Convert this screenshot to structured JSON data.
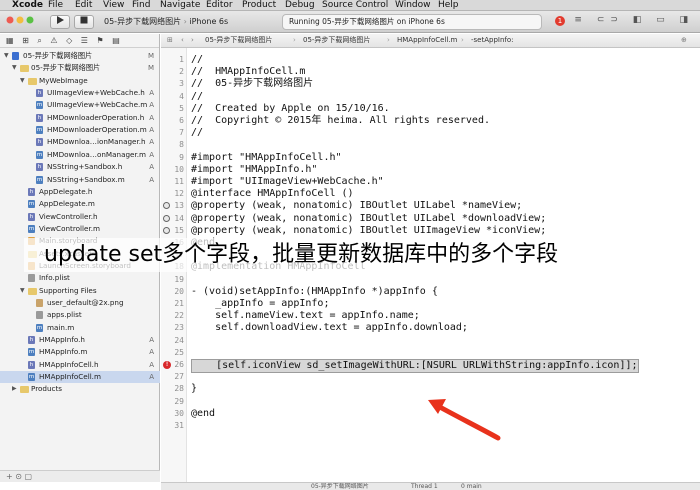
{
  "menubar": {
    "apple": "",
    "items": [
      "Xcode",
      "File",
      "Edit",
      "View",
      "Find",
      "Navigate",
      "Editor",
      "Product",
      "Debug",
      "Source Control",
      "Window",
      "Help"
    ]
  },
  "toolbar": {
    "scheme_project": "05-异步下载网络图片",
    "scheme_device": "iPhone 6s",
    "activity": "Running 05-异步下载网络图片 on iPhone 6s",
    "warning_count": "1"
  },
  "navigator": {
    "items": [
      {
        "label": "05-异步下载网络图片",
        "status": "M",
        "level": 0,
        "type": "proj",
        "disclosure": "▼"
      },
      {
        "label": "05-异步下载网络图片",
        "status": "M",
        "level": 1,
        "type": "folder",
        "disclosure": "▼"
      },
      {
        "label": "MyWebImage",
        "status": "",
        "level": 2,
        "type": "folder",
        "disclosure": "▼"
      },
      {
        "label": "UIImageView+WebCache.h",
        "status": "A",
        "level": 3,
        "type": "h",
        "disclosure": ""
      },
      {
        "label": "UIImageView+WebCache.m",
        "status": "A",
        "level": 3,
        "type": "m",
        "disclosure": ""
      },
      {
        "label": "HMDownloaderOperation.h",
        "status": "A",
        "level": 3,
        "type": "h",
        "disclosure": ""
      },
      {
        "label": "HMDownloaderOperation.m",
        "status": "A",
        "level": 3,
        "type": "m",
        "disclosure": ""
      },
      {
        "label": "HMDownloa…ionManager.h",
        "status": "A",
        "level": 3,
        "type": "h",
        "disclosure": ""
      },
      {
        "label": "HMDownloa…onManager.m",
        "status": "A",
        "level": 3,
        "type": "m",
        "disclosure": ""
      },
      {
        "label": "NSString+Sandbox.h",
        "status": "A",
        "level": 3,
        "type": "h",
        "disclosure": ""
      },
      {
        "label": "NSString+Sandbox.m",
        "status": "A",
        "level": 3,
        "type": "m",
        "disclosure": ""
      },
      {
        "label": "AppDelegate.h",
        "status": "",
        "level": 2,
        "type": "h",
        "disclosure": ""
      },
      {
        "label": "AppDelegate.m",
        "status": "",
        "level": 2,
        "type": "m",
        "disclosure": ""
      },
      {
        "label": "ViewController.h",
        "status": "",
        "level": 2,
        "type": "h",
        "disclosure": ""
      },
      {
        "label": "ViewController.m",
        "status": "",
        "level": 2,
        "type": "m",
        "disclosure": ""
      },
      {
        "label": "Main.storyboard",
        "status": "",
        "level": 2,
        "type": "sb",
        "disclosure": ""
      },
      {
        "label": "Assets.xcassets",
        "status": "",
        "level": 2,
        "type": "folder",
        "disclosure": ""
      },
      {
        "label": "LaunchScreen.storyboard",
        "status": "",
        "level": 2,
        "type": "sb",
        "disclosure": ""
      },
      {
        "label": "Info.plist",
        "status": "",
        "level": 2,
        "type": "plist",
        "disclosure": ""
      },
      {
        "label": "Supporting Files",
        "status": "",
        "level": 2,
        "type": "folder",
        "disclosure": "▼"
      },
      {
        "label": "user_default@2x.png",
        "status": "",
        "level": 3,
        "type": "png",
        "disclosure": ""
      },
      {
        "label": "apps.plist",
        "status": "",
        "level": 3,
        "type": "plist",
        "disclosure": ""
      },
      {
        "label": "main.m",
        "status": "",
        "level": 3,
        "type": "m",
        "disclosure": ""
      },
      {
        "label": "HMAppInfo.h",
        "status": "A",
        "level": 2,
        "type": "h",
        "disclosure": ""
      },
      {
        "label": "HMAppInfo.m",
        "status": "A",
        "level": 2,
        "type": "m",
        "disclosure": ""
      },
      {
        "label": "HMAppInfoCell.h",
        "status": "A",
        "level": 2,
        "type": "h",
        "disclosure": ""
      },
      {
        "label": "HMAppInfoCell.m",
        "status": "A",
        "level": 2,
        "type": "m",
        "disclosure": "",
        "selected": true
      },
      {
        "label": "Products",
        "status": "",
        "level": 1,
        "type": "folder",
        "disclosure": "▶"
      }
    ]
  },
  "jumpbar": {
    "crumbs": [
      "05-异步下载网络图片",
      "05-异步下载网络图片",
      "HMAppInfoCell.m",
      "-setAppInfo:"
    ]
  },
  "editor": {
    "lines": [
      {
        "n": "1",
        "code": "//"
      },
      {
        "n": "2",
        "code": "//  HMAppInfoCell.m"
      },
      {
        "n": "3",
        "code": "//  05-异步下载网络图片"
      },
      {
        "n": "4",
        "code": "//"
      },
      {
        "n": "5",
        "code": "//  Created by Apple on 15/10/16."
      },
      {
        "n": "6",
        "code": "//  Copyright © 2015年 heima. All rights reserved."
      },
      {
        "n": "7",
        "code": "//"
      },
      {
        "n": "8",
        "code": ""
      },
      {
        "n": "9",
        "code": "#import \"HMAppInfoCell.h\""
      },
      {
        "n": "10",
        "code": "#import \"HMAppInfo.h\""
      },
      {
        "n": "11",
        "code": "#import \"UIImageView+WebCache.h\""
      },
      {
        "n": "12",
        "code": "@interface HMAppInfoCell ()"
      },
      {
        "n": "13",
        "code": "@property (weak, nonatomic) IBOutlet UILabel *nameView;"
      },
      {
        "n": "14",
        "code": "@property (weak, nonatomic) IBOutlet UILabel *downloadView;"
      },
      {
        "n": "15",
        "code": "@property (weak, nonatomic) IBOutlet UIImageView *iconView;"
      },
      {
        "n": "16",
        "code": "@end"
      },
      {
        "n": "17",
        "code": ""
      },
      {
        "n": "18",
        "code": "@implementation HMAppInfoCell"
      },
      {
        "n": "19",
        "code": ""
      },
      {
        "n": "20",
        "code": "- (void)setAppInfo:(HMAppInfo *)appInfo {"
      },
      {
        "n": "21",
        "code": "    _appInfo = appInfo;"
      },
      {
        "n": "22",
        "code": "    self.nameView.text = appInfo.name;"
      },
      {
        "n": "23",
        "code": "    self.downloadView.text = appInfo.download;"
      },
      {
        "n": "24",
        "code": ""
      },
      {
        "n": "25",
        "code": ""
      },
      {
        "n": "26",
        "code": "    [self.iconView sd_setImageWithURL:[NSURL URLWithString:appInfo.icon]];"
      },
      {
        "n": "27",
        "code": ""
      },
      {
        "n": "28",
        "code": "}"
      },
      {
        "n": "29",
        "code": ""
      },
      {
        "n": "30",
        "code": "@end"
      },
      {
        "n": "31",
        "code": ""
      }
    ]
  },
  "overlay": {
    "caption": "update set多个字段，批量更新数据库中的多个字段"
  },
  "bottombar": {
    "crumbs": [
      "05-异步下载网络图片",
      "Thread 1",
      "0 main"
    ]
  },
  "colors": {
    "comment": "#1d7a1d",
    "string": "#c41a16",
    "keyword": "#aa0d91",
    "error": "#d8282b",
    "arrow": "#e8321c",
    "selection": "#c9d7ee"
  },
  "icons": {
    "run": "play-icon",
    "stop": "stop-icon",
    "nav_back": "chevron-left-icon",
    "nav_forward": "chevron-right-icon"
  }
}
